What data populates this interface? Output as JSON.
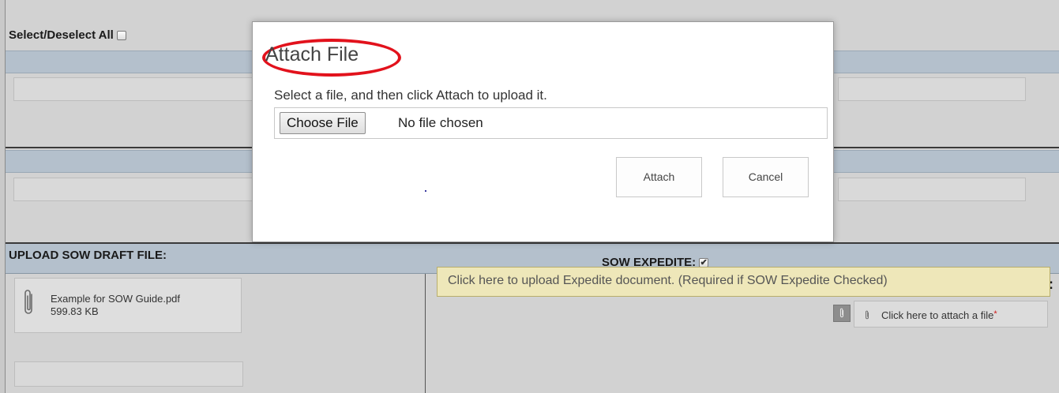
{
  "form": {
    "select_all_label": "Select/Deselect All",
    "upload_header": "UPLOAD SOW DRAFT FILE:",
    "sow_expedite_label": "SOW EXPEDITE:",
    "sow_expedite_checked": true
  },
  "attachment": {
    "file_name": "Example for SOW Guide.pdf",
    "file_size": "599.83 KB"
  },
  "tooltip": {
    "text": "Click here to upload Expedite document. (Required if SOW Expedite Checked)"
  },
  "expedite_attach": {
    "link_label": "Click here to attach a file",
    "required_marker": "*",
    "trailing_char": ":"
  },
  "modal": {
    "title": "Attach File",
    "description": "Select a file, and then click Attach to upload it.",
    "choose_button": "Choose File",
    "no_file_text": "No file chosen",
    "attach_button": "Attach",
    "cancel_button": "Cancel",
    "highlight_color": "#e2121c"
  },
  "icons": [
    "paperclip-icon",
    "checkbox-icon"
  ]
}
